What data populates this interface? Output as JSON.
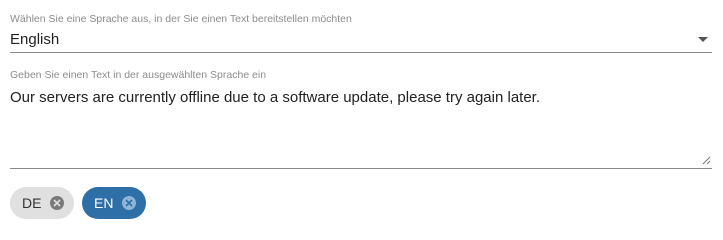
{
  "language_select": {
    "label": "Wählen Sie eine Sprache aus, in der Sie einen Text bereitstellen möchten",
    "value": "English"
  },
  "text_input": {
    "label": "Geben Sie einen Text in der ausgewählten Sprache ein",
    "value": "Our servers are currently offline due to a software update, please try again later."
  },
  "chips": [
    {
      "label": "DE",
      "selected": false
    },
    {
      "label": "EN",
      "selected": true
    }
  ],
  "colors": {
    "chip_selected": "#2f6fa8",
    "chip_unselected": "#e0e0e0"
  },
  "icons": {
    "select_arrow": "caret-down-icon",
    "chip_close": "close-circle-icon",
    "resize": "resize-handle-icon"
  }
}
